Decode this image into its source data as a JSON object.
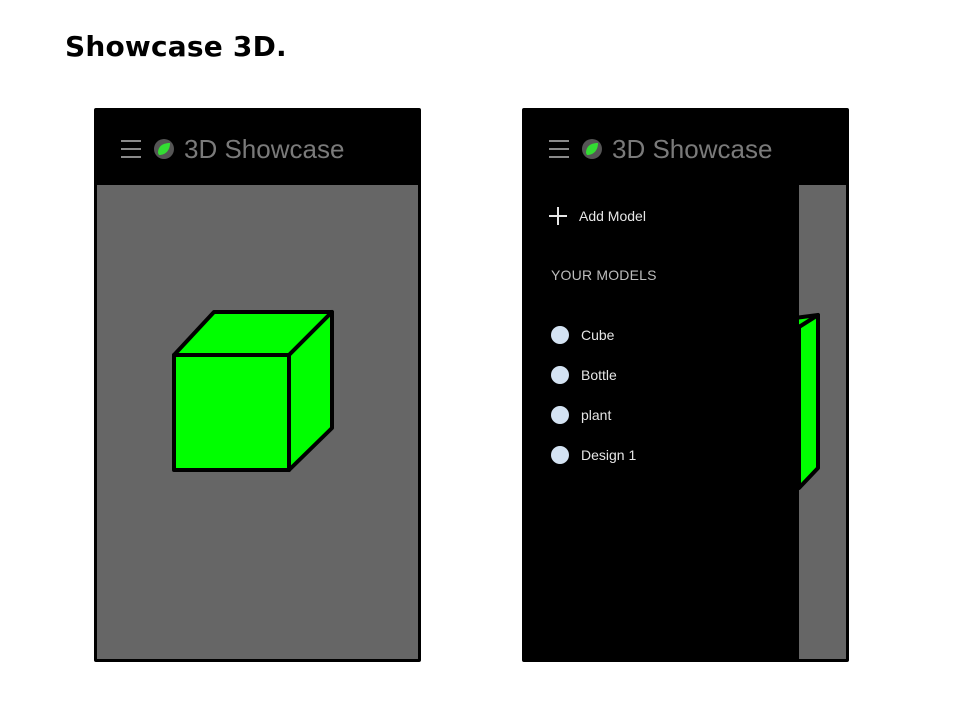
{
  "page": {
    "title": "Showcase 3D."
  },
  "app": {
    "title": "3D Showcase",
    "icons": {
      "menu": "hamburger-menu-icon",
      "logo": "green-leaf-logo-icon"
    }
  },
  "colors": {
    "header_bg": "#000000",
    "viewport_bg": "#666666",
    "cube_fill": "#00ff00",
    "logo_outer": "#555555",
    "logo_inner": "#33dd33",
    "model_dot": "#d4e3f3"
  },
  "drawer": {
    "add_label": "Add Model",
    "section_title": "YOUR MODELS",
    "models": [
      {
        "label": "Cube"
      },
      {
        "label": "Bottle"
      },
      {
        "label": "plant"
      },
      {
        "label": "Design 1"
      }
    ]
  }
}
